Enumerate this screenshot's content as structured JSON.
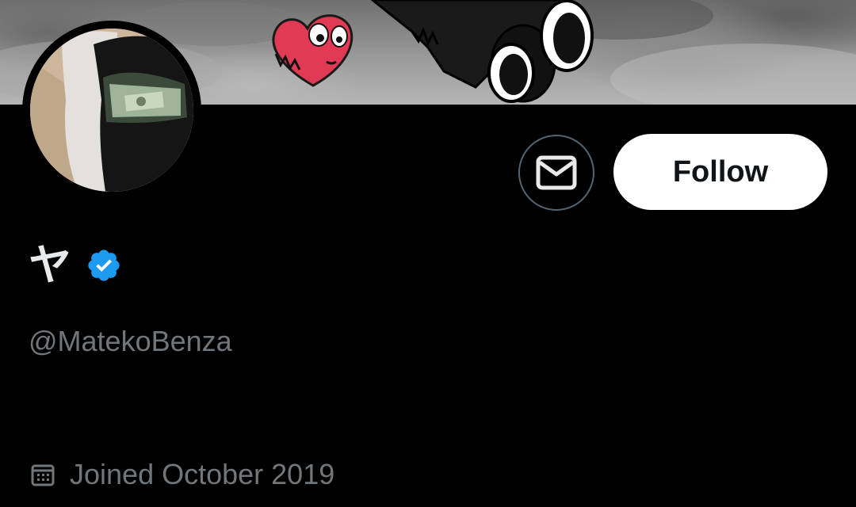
{
  "profile": {
    "display_name": "ヤ",
    "handle": "@MatekoBenza",
    "joined": "Joined October 2019",
    "verified": true
  },
  "actions": {
    "follow_label": "Follow",
    "message_icon": "envelope-icon"
  },
  "colors": {
    "background": "#000000",
    "verified_blue": "#1d9bf0",
    "secondary_text": "#71767b",
    "follow_bg": "#ffffff"
  }
}
